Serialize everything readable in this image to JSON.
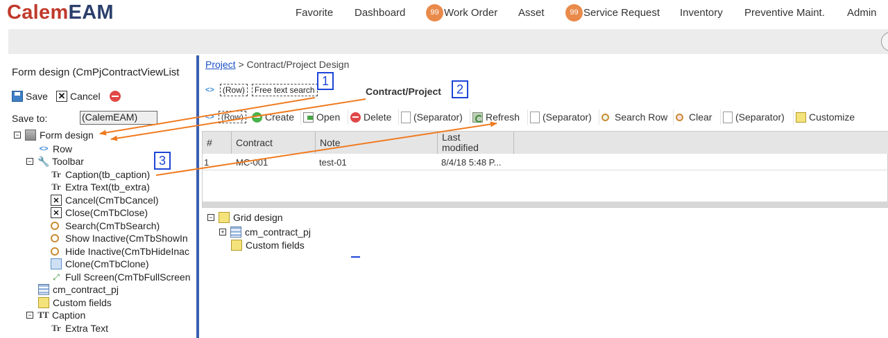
{
  "header": {
    "logo_calem": "Calem",
    "logo_eam": "EAM",
    "nav": [
      {
        "label": "Favorite"
      },
      {
        "label": "Dashboard"
      },
      {
        "label": "Work Order",
        "badge": "99"
      },
      {
        "label": "Asset"
      },
      {
        "label": "Service Request",
        "badge": "99"
      },
      {
        "label": "Inventory"
      },
      {
        "label": "Preventive Maint."
      },
      {
        "label": "Admin"
      }
    ]
  },
  "left_panel": {
    "title": "Form design (CmPjContractViewList",
    "save_label": "Save",
    "cancel_label": "Cancel",
    "save_to_label": "Save to:",
    "save_to_value": "(CalemEAM)",
    "tree": [
      {
        "label": "Form design"
      },
      {
        "label": "Row"
      },
      {
        "label": "Toolbar"
      },
      {
        "label": "Caption(tb_caption)"
      },
      {
        "label": "Extra Text(tb_extra)"
      },
      {
        "label": "Cancel(CmTbCancel)"
      },
      {
        "label": "Close(CmTbClose)"
      },
      {
        "label": "Search(CmTbSearch)"
      },
      {
        "label": "Show Inactive(CmTbShowIn"
      },
      {
        "label": "Hide Inactive(CmTbHideInac"
      },
      {
        "label": "Clone(CmTbClone)"
      },
      {
        "label": "Full Screen(CmTbFullScreen"
      },
      {
        "label": "cm_contract_pj"
      },
      {
        "label": "Custom fields"
      },
      {
        "label": "Caption"
      },
      {
        "label": "Extra Text"
      }
    ]
  },
  "main": {
    "breadcrumb_link": "Project",
    "breadcrumb_rest": " > Contract/Project Design",
    "row_label": "(Row)",
    "free_text_search": "Free text search",
    "caption": "Contract/Project",
    "annotations": [
      "1",
      "2",
      "3"
    ],
    "toolbar": [
      {
        "label": "(Row)"
      },
      {
        "label": "Create"
      },
      {
        "label": "Open"
      },
      {
        "label": "Delete"
      },
      {
        "label": "(Separator)"
      },
      {
        "label": "Refresh"
      },
      {
        "label": "(Separator)"
      },
      {
        "label": "Search Row"
      },
      {
        "label": "Clear"
      },
      {
        "label": "(Separator)"
      },
      {
        "label": "Customize"
      }
    ],
    "grid": {
      "columns": [
        "#",
        "Contract",
        "Note",
        "Last modified"
      ],
      "rows": [
        [
          "1",
          "MC-001",
          "test-01",
          "8/4/18 5:48 P..."
        ]
      ]
    },
    "grid_tree": [
      {
        "label": "Grid design"
      },
      {
        "label": "cm_contract_pj"
      },
      {
        "label": "Custom fields"
      }
    ]
  },
  "colors": {
    "logo_red": "#c0392b",
    "logo_navy": "#2b3f6b",
    "badge_orange": "#e98a4a",
    "divider_blue": "#3a5fb0",
    "annotation_blue": "#1b45d8",
    "arrow_orange": "#f07a1e"
  }
}
